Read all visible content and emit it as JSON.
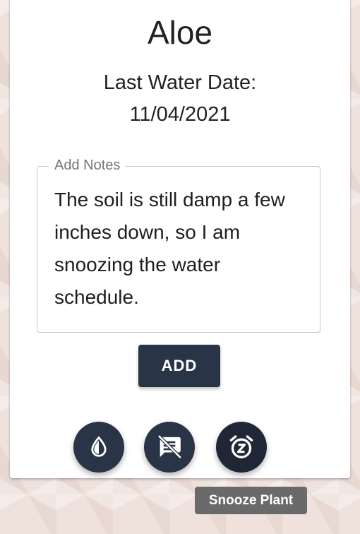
{
  "plant": {
    "name": "Aloe",
    "last_water_label": "Last Water Date:",
    "last_water_date": "11/04/2021"
  },
  "notes": {
    "label": "Add Notes",
    "value": "The soil is still damp a few inches down, so I am snoozing the water schedule."
  },
  "buttons": {
    "add_label": "ADD"
  },
  "actions": [
    {
      "name": "water",
      "icon": "water-drop-icon"
    },
    {
      "name": "notes-off",
      "icon": "comments-disabled-icon"
    },
    {
      "name": "snooze",
      "icon": "snooze-alarm-icon"
    }
  ],
  "tooltip": {
    "text": "Snooze Plant"
  },
  "colors": {
    "primary": "#293447",
    "background": "#efe1dc",
    "tooltip": "#6a6a6a"
  }
}
